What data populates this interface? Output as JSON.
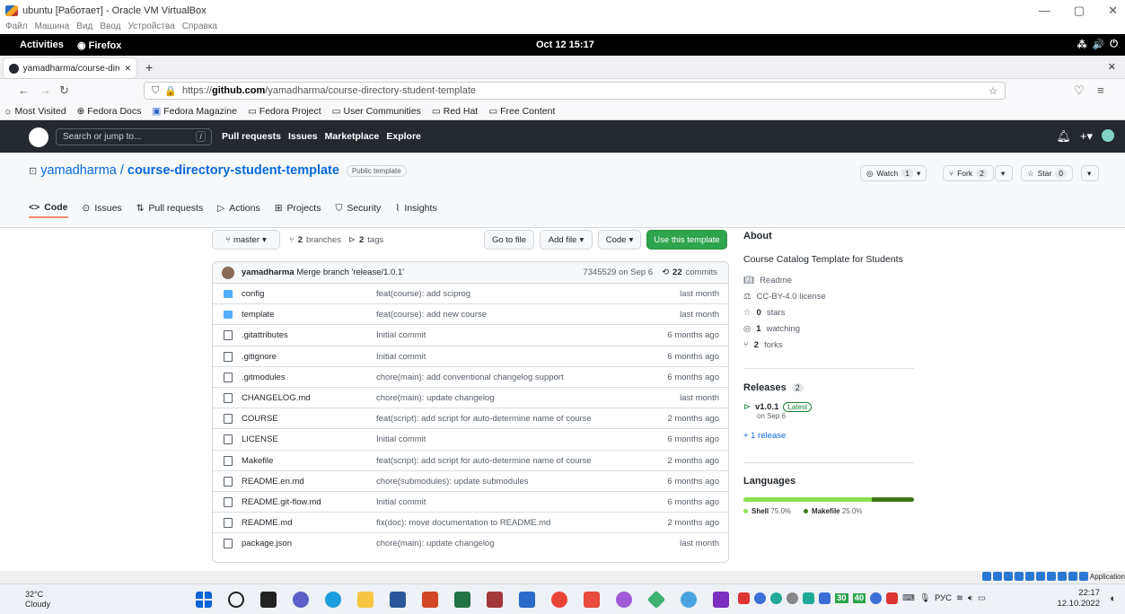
{
  "vbox": {
    "title": "ubuntu [Работает] - Oracle VM VirtualBox",
    "menu": [
      "Файл",
      "Машина",
      "Вид",
      "Ввод",
      "Устройства",
      "Справка"
    ],
    "controls": [
      "—",
      "▢",
      "✕"
    ]
  },
  "gnome": {
    "activities": "Activities",
    "app": "Firefox",
    "clock": "Oct 12  15:17"
  },
  "browser": {
    "tab_title": "yamadharma/course-dire",
    "url_prefix": "https://",
    "url_domain": "github.com",
    "url_path": "/yamadharma/course-directory-student-template",
    "bookmarks": [
      "Most Visited",
      "Fedora Docs",
      "Fedora Magazine",
      "Fedora Project",
      "User Communities",
      "Red Hat",
      "Free Content"
    ]
  },
  "github": {
    "search_placeholder": "Search or jump to...",
    "search_key": "/",
    "nav": [
      "Pull requests",
      "Issues",
      "Marketplace",
      "Explore"
    ],
    "owner": "yamadharma",
    "repo": "course-directory-student-template",
    "visibility": "Public template",
    "watch": {
      "label": "Watch",
      "count": "1"
    },
    "fork": {
      "label": "Fork",
      "count": "2"
    },
    "star": {
      "label": "Star",
      "count": "0"
    },
    "tabs": [
      "Code",
      "Issues",
      "Pull requests",
      "Actions",
      "Projects",
      "Security",
      "Insights"
    ],
    "branch": "master",
    "branches": {
      "count": "2",
      "label": "branches"
    },
    "tags": {
      "count": "2",
      "label": "tags"
    },
    "buttons": {
      "goto": "Go to file",
      "add": "Add file",
      "code": "Code",
      "template": "Use this template"
    },
    "last_commit": {
      "author": "yamadharma",
      "message": "Merge branch 'release/1.0.1'",
      "sha_date": "7345529 on Sep 6",
      "commits_count": "22",
      "commits_label": "commits"
    },
    "files": [
      {
        "type": "folder",
        "name": "config",
        "msg": "feat(course): add sciprog",
        "age": "last month"
      },
      {
        "type": "folder",
        "name": "template",
        "msg": "feat(course): add new course",
        "age": "last month"
      },
      {
        "type": "file",
        "name": ".gitattributes",
        "msg": "Initial commit",
        "age": "6 months ago"
      },
      {
        "type": "file",
        "name": ".gitignore",
        "msg": "Initial commit",
        "age": "6 months ago"
      },
      {
        "type": "file",
        "name": ".gitmodules",
        "msg": "chore(main): add conventional changelog support",
        "age": "6 months ago"
      },
      {
        "type": "file",
        "name": "CHANGELOG.md",
        "msg": "chore(main): update changelog",
        "age": "last month"
      },
      {
        "type": "file",
        "name": "COURSE",
        "msg": "feat(script): add script for auto-determine name of course",
        "age": "2 months ago"
      },
      {
        "type": "file",
        "name": "LICENSE",
        "msg": "Initial commit",
        "age": "6 months ago"
      },
      {
        "type": "file",
        "name": "Makefile",
        "msg": "feat(script): add script for auto-determine name of course",
        "age": "2 months ago"
      },
      {
        "type": "file",
        "name": "README.en.md",
        "msg": "chore(submodules): update submodules",
        "age": "6 months ago"
      },
      {
        "type": "file",
        "name": "README.git-flow.md",
        "msg": "Initial commit",
        "age": "6 months ago"
      },
      {
        "type": "file",
        "name": "README.md",
        "msg": "fix(doc): move documentation to README.md",
        "age": "2 months ago"
      },
      {
        "type": "file",
        "name": "package.json",
        "msg": "chore(main): update changelog",
        "age": "last month"
      }
    ],
    "about": {
      "heading": "About",
      "description": "Course Catalog Template for Students",
      "readme": "Readme",
      "license": "CC-BY-4.0 license",
      "stars_count": "0",
      "stars_label": "stars",
      "watching_count": "1",
      "watching_label": "watching",
      "forks_count": "2",
      "forks_label": "forks"
    },
    "releases": {
      "heading": "Releases",
      "count": "2",
      "version": "v1.0.1",
      "latest": "Latest",
      "date": "on Sep 6",
      "more": "+ 1 release"
    },
    "languages": {
      "heading": "Languages",
      "items": [
        {
          "name": "Shell",
          "pct": "75.0%",
          "value": 75.0,
          "color": "#89e051"
        },
        {
          "name": "Makefile",
          "pct": "25.0%",
          "value": 25.0,
          "color": "#427819"
        }
      ]
    }
  },
  "taskbar": {
    "temp": "32°C",
    "weather": "Cloudy",
    "vbox_status_label": "Application",
    "tray_numbers": [
      "30",
      "40"
    ],
    "lang": "РУС",
    "time": "22:17",
    "date": "12.10.2022"
  }
}
